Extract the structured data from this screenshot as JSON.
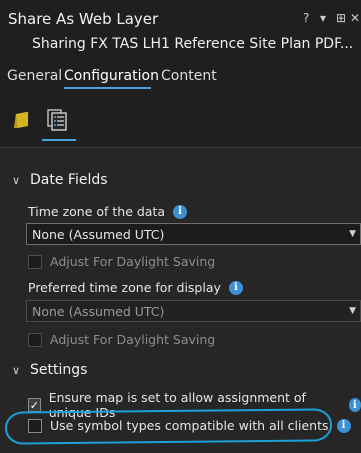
{
  "window": {
    "title": "Share As Web Layer",
    "help_glyph": "?",
    "menu_glyph": "▾",
    "pin_glyph": "⊞",
    "close_glyph": "✕",
    "subtitle": "Sharing FX TAS LH1 Reference Site Plan PDF..."
  },
  "tabs": [
    {
      "label": "General"
    },
    {
      "label": "Configuration"
    },
    {
      "label": "Content"
    }
  ],
  "subtabs": [
    {
      "icon": "layers-icon"
    },
    {
      "icon": "properties-list-icon"
    }
  ],
  "date_fields": {
    "header": "Date Fields",
    "time_zone_label": "Time zone of the data",
    "time_zone_value": "None (Assumed UTC)",
    "adjust_dst_1": "Adjust For Daylight Saving",
    "pref_tz_label": "Preferred time zone for display",
    "pref_tz_value": "None (Assumed UTC)",
    "adjust_dst_2": "Adjust For Daylight Saving"
  },
  "settings": {
    "header": "Settings",
    "unique_ids": "Ensure map is set to allow assignment of unique IDs",
    "symbol_types": "Use symbol types compatible with all clients"
  },
  "colors": {
    "accent": "#4aa3df",
    "info_icon": "#3d8fd6",
    "highlight": "#1e9fd6"
  }
}
